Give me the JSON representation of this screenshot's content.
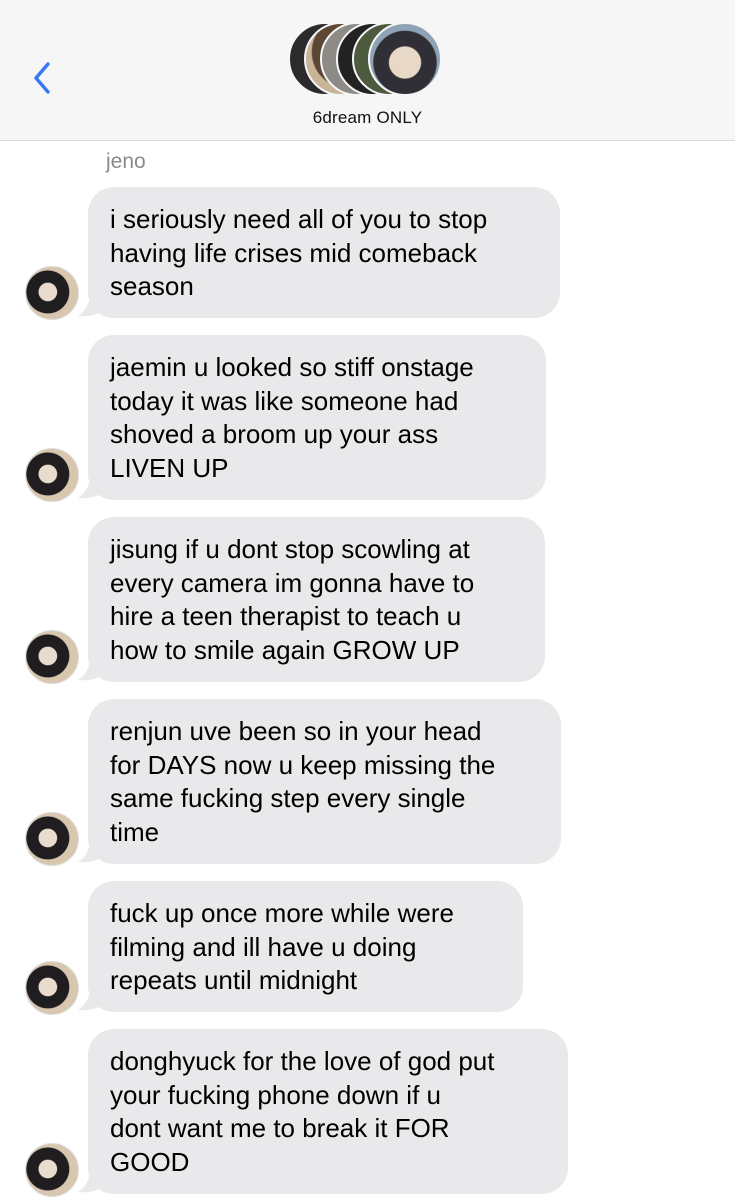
{
  "header": {
    "group_name": "6dream ONLY",
    "member_avatar_count": 6
  },
  "thread": {
    "sender_name": "jeno",
    "bubble_color": "#e9e9eb",
    "accent_color": "#3478f6",
    "messages": [
      {
        "lines": [
          "i seriously need all of you to stop",
          "having life crises mid comeback",
          "season"
        ]
      },
      {
        "lines": [
          "jaemin u looked so stiff onstage",
          "today it was like someone had",
          "shoved a broom up your ass",
          "LIVEN UP"
        ]
      },
      {
        "lines": [
          "jisung if u dont stop scowling at",
          "every camera im gonna have to",
          "hire a teen therapist to teach u",
          "how to smile again GROW UP"
        ]
      },
      {
        "lines": [
          "renjun uve been so in your head",
          "for DAYS now u keep missing the",
          "same fucking step every single",
          "time"
        ]
      },
      {
        "lines": [
          "fuck up once more while were",
          "filming and ill have u doing",
          "repeats until midnight"
        ]
      },
      {
        "lines": [
          "donghyuck for the love of god put",
          "your fucking phone down if u",
          "dont want me to break it FOR",
          "GOOD"
        ]
      }
    ]
  }
}
